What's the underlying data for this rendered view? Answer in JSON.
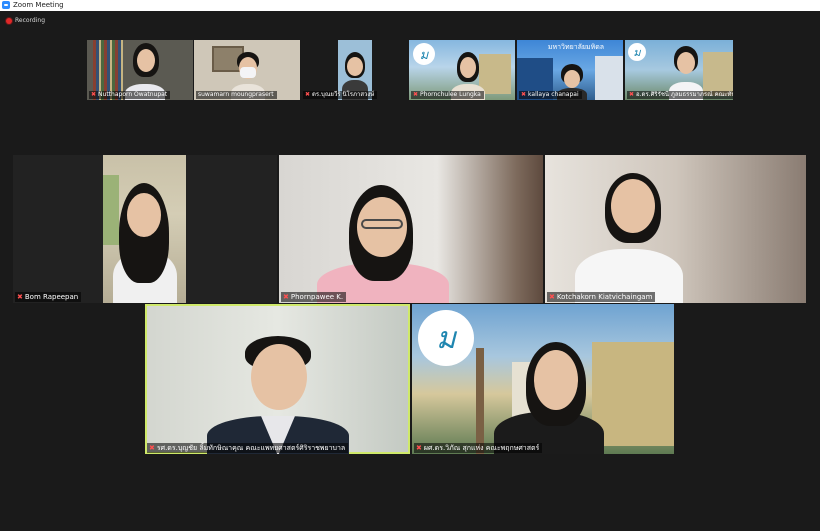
{
  "window": {
    "title": "Zoom Meeting"
  },
  "recording": {
    "label": "Recording"
  },
  "participants": [
    {
      "name": "Nutthaporn Owatnupat",
      "muted": true
    },
    {
      "name": "suwamarn moungprasert",
      "muted": false
    },
    {
      "name": "ดร.บุณยวีร์ นิโรภาสวงษ์",
      "muted": true
    },
    {
      "name": "Phornchulee Lungka",
      "muted": true
    },
    {
      "name": "kallaya chanapai",
      "muted": true
    },
    {
      "name": "อ.ดร.ศิริรัชนี ภูลมธรรมาภรณ์ คณะทันตแพทยศาสตร์",
      "muted": true
    },
    {
      "name": "Bom Rapeepan",
      "muted": true
    },
    {
      "name": "Phornpawee K.",
      "muted": true
    },
    {
      "name": "Kotchakorn Kiatvichaingam",
      "muted": true
    },
    {
      "name": "รศ.ดร.บุญชัย ลิ้มทักษิณาคุณ คณะแพทยศาสตร์ศิริราชพยาบาล",
      "muted": false
    },
    {
      "name": "ผศ.ดร.วิภัณ สุกแห่ง คณะพฤกษศาสตร์",
      "muted": false
    }
  ],
  "logo_text": "ม",
  "banner_text": "มหาวิทยาลัยมหิดล",
  "colors": {
    "active_border": "#cfe96a",
    "mute_icon": "#ff5050",
    "record_dot": "#e02828",
    "zoom_brand": "#2d8cff"
  }
}
